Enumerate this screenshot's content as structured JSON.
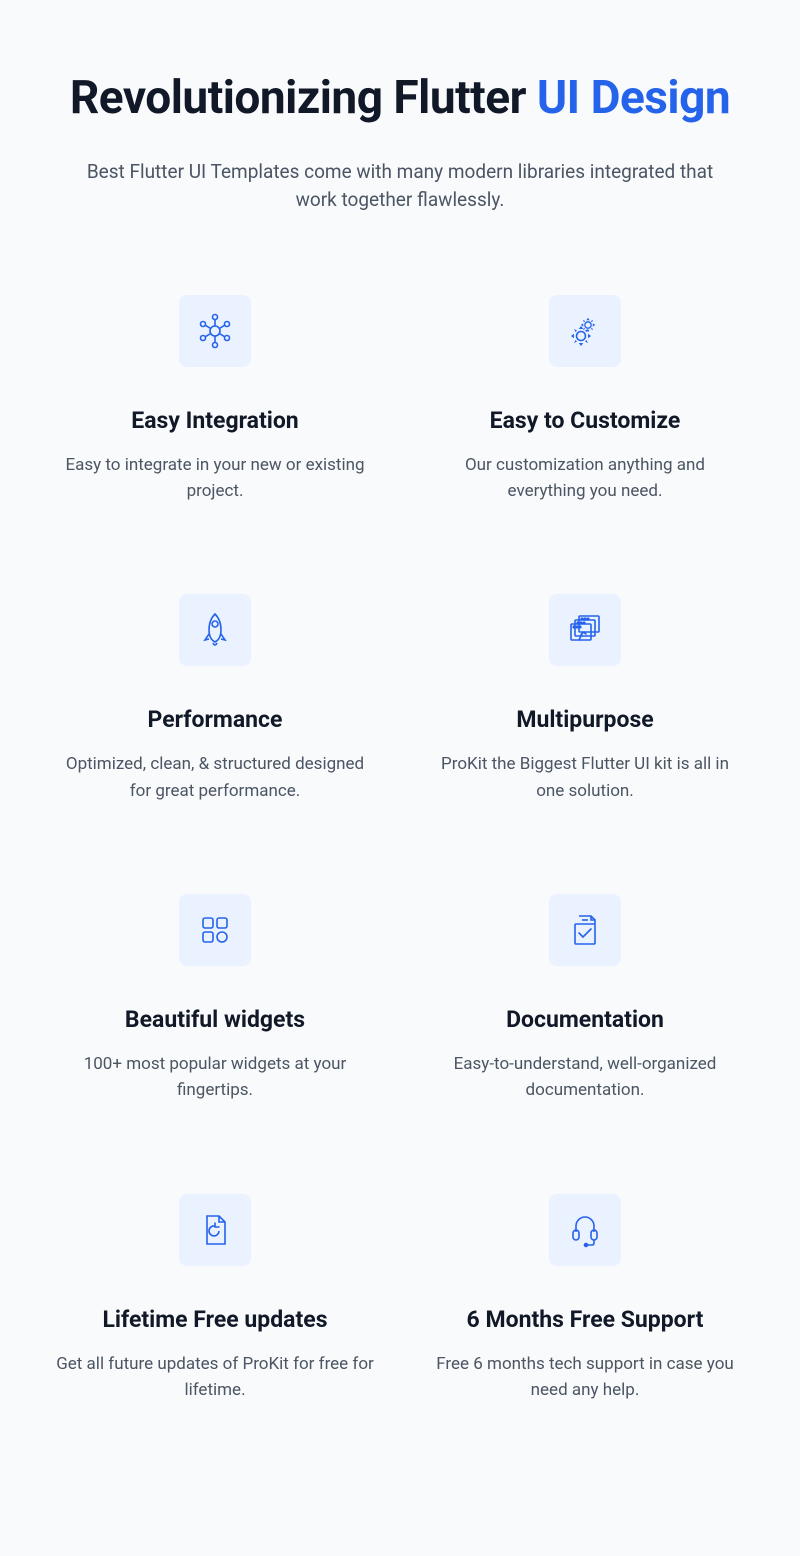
{
  "heading_main": "Revolutionizing Flutter ",
  "heading_accent": "UI Design",
  "subtitle": "Best Flutter UI Templates come with many modern libraries integrated that work together flawlessly.",
  "features": [
    {
      "title": "Easy Integration",
      "desc": "Easy to integrate in your new or existing project."
    },
    {
      "title": "Easy to Customize",
      "desc": "Our customization anything and everything you need."
    },
    {
      "title": "Performance",
      "desc": "Optimized, clean, & structured designed for great performance."
    },
    {
      "title": "Multipurpose",
      "desc": "ProKit the Biggest Flutter UI kit is all in one solution."
    },
    {
      "title": "Beautiful widgets",
      "desc": "100+ most popular widgets at your fingertips."
    },
    {
      "title": "Documentation",
      "desc": "Easy-to-understand, well-organized documentation."
    },
    {
      "title": "Lifetime Free updates",
      "desc": "Get all future updates of ProKit for free for lifetime."
    },
    {
      "title": "6 Months Free Support",
      "desc": "Free 6 months tech support in case you need any help."
    }
  ]
}
